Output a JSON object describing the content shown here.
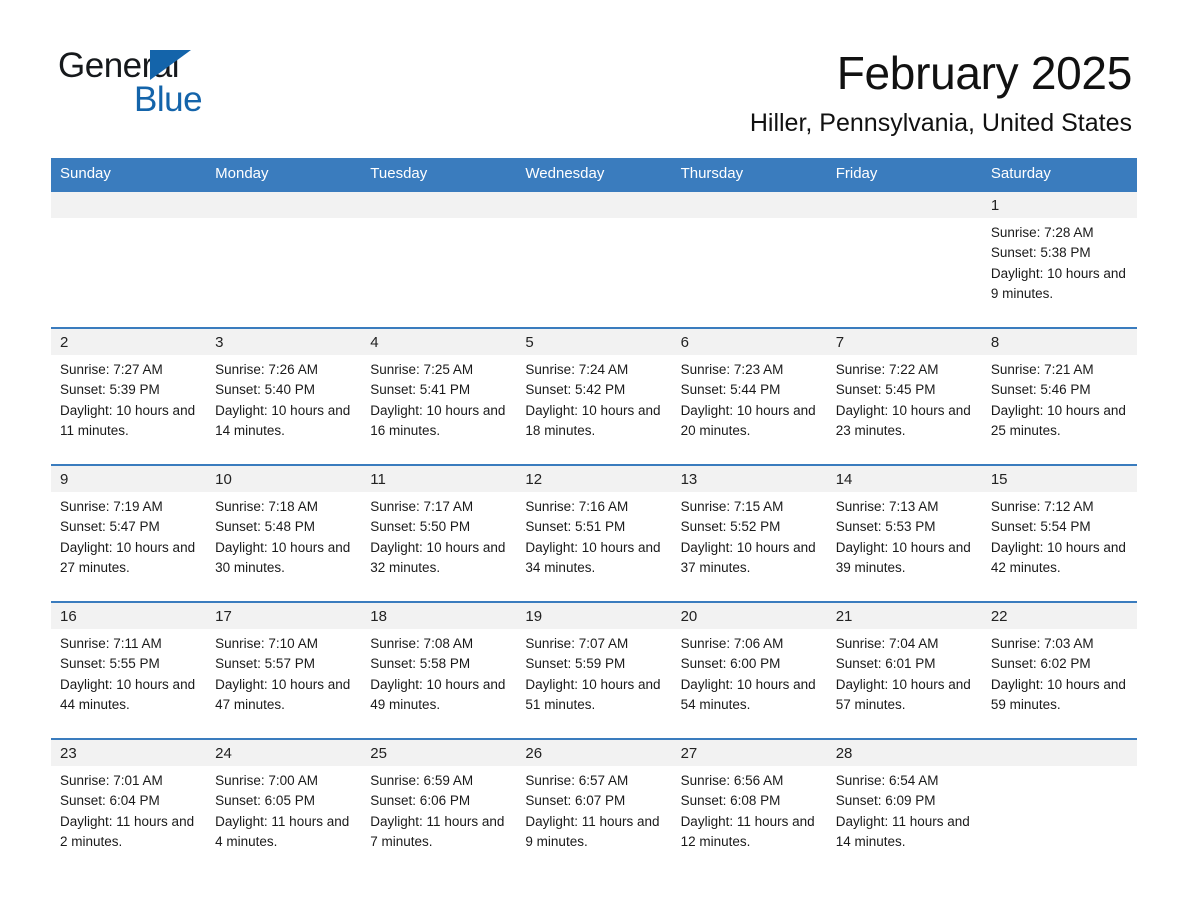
{
  "brand": {
    "name_part1": "General",
    "name_part2": "Blue",
    "triangle_color": "#1464aa"
  },
  "header": {
    "month_title": "February 2025",
    "location": "Hiller, Pennsylvania, United States"
  },
  "theme": {
    "header_bg": "#3a7cbe",
    "header_text": "#ffffff",
    "daynum_bg": "#f2f2f2",
    "row_border": "#3a7cbe",
    "body_text": "#1a1a1a"
  },
  "calendar": {
    "weekday_headers": [
      "Sunday",
      "Monday",
      "Tuesday",
      "Wednesday",
      "Thursday",
      "Friday",
      "Saturday"
    ],
    "weeks": [
      [
        {
          "day": "",
          "empty": true
        },
        {
          "day": "",
          "empty": true
        },
        {
          "day": "",
          "empty": true
        },
        {
          "day": "",
          "empty": true
        },
        {
          "day": "",
          "empty": true
        },
        {
          "day": "",
          "empty": true
        },
        {
          "day": "1",
          "sunrise": "Sunrise: 7:28 AM",
          "sunset": "Sunset: 5:38 PM",
          "daylight": "Daylight: 10 hours and 9 minutes."
        }
      ],
      [
        {
          "day": "2",
          "sunrise": "Sunrise: 7:27 AM",
          "sunset": "Sunset: 5:39 PM",
          "daylight": "Daylight: 10 hours and 11 minutes."
        },
        {
          "day": "3",
          "sunrise": "Sunrise: 7:26 AM",
          "sunset": "Sunset: 5:40 PM",
          "daylight": "Daylight: 10 hours and 14 minutes."
        },
        {
          "day": "4",
          "sunrise": "Sunrise: 7:25 AM",
          "sunset": "Sunset: 5:41 PM",
          "daylight": "Daylight: 10 hours and 16 minutes."
        },
        {
          "day": "5",
          "sunrise": "Sunrise: 7:24 AM",
          "sunset": "Sunset: 5:42 PM",
          "daylight": "Daylight: 10 hours and 18 minutes."
        },
        {
          "day": "6",
          "sunrise": "Sunrise: 7:23 AM",
          "sunset": "Sunset: 5:44 PM",
          "daylight": "Daylight: 10 hours and 20 minutes."
        },
        {
          "day": "7",
          "sunrise": "Sunrise: 7:22 AM",
          "sunset": "Sunset: 5:45 PM",
          "daylight": "Daylight: 10 hours and 23 minutes."
        },
        {
          "day": "8",
          "sunrise": "Sunrise: 7:21 AM",
          "sunset": "Sunset: 5:46 PM",
          "daylight": "Daylight: 10 hours and 25 minutes."
        }
      ],
      [
        {
          "day": "9",
          "sunrise": "Sunrise: 7:19 AM",
          "sunset": "Sunset: 5:47 PM",
          "daylight": "Daylight: 10 hours and 27 minutes."
        },
        {
          "day": "10",
          "sunrise": "Sunrise: 7:18 AM",
          "sunset": "Sunset: 5:48 PM",
          "daylight": "Daylight: 10 hours and 30 minutes."
        },
        {
          "day": "11",
          "sunrise": "Sunrise: 7:17 AM",
          "sunset": "Sunset: 5:50 PM",
          "daylight": "Daylight: 10 hours and 32 minutes."
        },
        {
          "day": "12",
          "sunrise": "Sunrise: 7:16 AM",
          "sunset": "Sunset: 5:51 PM",
          "daylight": "Daylight: 10 hours and 34 minutes."
        },
        {
          "day": "13",
          "sunrise": "Sunrise: 7:15 AM",
          "sunset": "Sunset: 5:52 PM",
          "daylight": "Daylight: 10 hours and 37 minutes."
        },
        {
          "day": "14",
          "sunrise": "Sunrise: 7:13 AM",
          "sunset": "Sunset: 5:53 PM",
          "daylight": "Daylight: 10 hours and 39 minutes."
        },
        {
          "day": "15",
          "sunrise": "Sunrise: 7:12 AM",
          "sunset": "Sunset: 5:54 PM",
          "daylight": "Daylight: 10 hours and 42 minutes."
        }
      ],
      [
        {
          "day": "16",
          "sunrise": "Sunrise: 7:11 AM",
          "sunset": "Sunset: 5:55 PM",
          "daylight": "Daylight: 10 hours and 44 minutes."
        },
        {
          "day": "17",
          "sunrise": "Sunrise: 7:10 AM",
          "sunset": "Sunset: 5:57 PM",
          "daylight": "Daylight: 10 hours and 47 minutes."
        },
        {
          "day": "18",
          "sunrise": "Sunrise: 7:08 AM",
          "sunset": "Sunset: 5:58 PM",
          "daylight": "Daylight: 10 hours and 49 minutes."
        },
        {
          "day": "19",
          "sunrise": "Sunrise: 7:07 AM",
          "sunset": "Sunset: 5:59 PM",
          "daylight": "Daylight: 10 hours and 51 minutes."
        },
        {
          "day": "20",
          "sunrise": "Sunrise: 7:06 AM",
          "sunset": "Sunset: 6:00 PM",
          "daylight": "Daylight: 10 hours and 54 minutes."
        },
        {
          "day": "21",
          "sunrise": "Sunrise: 7:04 AM",
          "sunset": "Sunset: 6:01 PM",
          "daylight": "Daylight: 10 hours and 57 minutes."
        },
        {
          "day": "22",
          "sunrise": "Sunrise: 7:03 AM",
          "sunset": "Sunset: 6:02 PM",
          "daylight": "Daylight: 10 hours and 59 minutes."
        }
      ],
      [
        {
          "day": "23",
          "sunrise": "Sunrise: 7:01 AM",
          "sunset": "Sunset: 6:04 PM",
          "daylight": "Daylight: 11 hours and 2 minutes."
        },
        {
          "day": "24",
          "sunrise": "Sunrise: 7:00 AM",
          "sunset": "Sunset: 6:05 PM",
          "daylight": "Daylight: 11 hours and 4 minutes."
        },
        {
          "day": "25",
          "sunrise": "Sunrise: 6:59 AM",
          "sunset": "Sunset: 6:06 PM",
          "daylight": "Daylight: 11 hours and 7 minutes."
        },
        {
          "day": "26",
          "sunrise": "Sunrise: 6:57 AM",
          "sunset": "Sunset: 6:07 PM",
          "daylight": "Daylight: 11 hours and 9 minutes."
        },
        {
          "day": "27",
          "sunrise": "Sunrise: 6:56 AM",
          "sunset": "Sunset: 6:08 PM",
          "daylight": "Daylight: 11 hours and 12 minutes."
        },
        {
          "day": "28",
          "sunrise": "Sunrise: 6:54 AM",
          "sunset": "Sunset: 6:09 PM",
          "daylight": "Daylight: 11 hours and 14 minutes."
        },
        {
          "day": "",
          "empty": true
        }
      ]
    ]
  }
}
